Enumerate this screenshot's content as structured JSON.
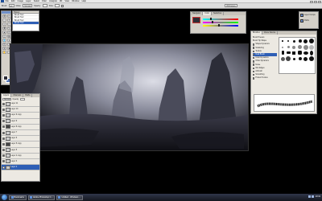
{
  "menubar": {
    "items": [
      "File",
      "Edit",
      "Image",
      "Layer",
      "Select",
      "Filter",
      "Analysis",
      "3D",
      "View",
      "Window",
      "Help"
    ]
  },
  "options_bar": {
    "brush_label": "Brush:",
    "mode_label": "Mode:",
    "mode_value": "Normal",
    "opacity_label": "Opacity:",
    "flow_label": "Flow:",
    "workspace_label": "Workspace"
  },
  "history": {
    "title": "History",
    "items": [
      "Brush Tool",
      "Brush Tool",
      "Brush Tool",
      "Brush Tool"
    ]
  },
  "navigator": {
    "tabs": [
      "Navigator",
      "Color",
      "Swatches"
    ],
    "active_tab": "Color"
  },
  "right_strip": {
    "items": [
      "Layer Comps",
      "Paths"
    ]
  },
  "brushes": {
    "tabs": [
      "Brushes",
      "Clone Source"
    ],
    "options": [
      "Brush Presets",
      "Brush Tip Shape",
      "Shape Dynamics",
      "Scattering",
      "Texture",
      "Dual Brush",
      "Color Dynamics",
      "Other Dynamics",
      "Noise",
      "Wet Edges",
      "Airbrush",
      "Smoothing",
      "Protect Texture"
    ],
    "selected_option": "Dual Brush"
  },
  "layers": {
    "tabs": [
      "Layers",
      "Channels",
      "Paths"
    ],
    "blend_mode": "Normal",
    "opacity_label": "Opacity:",
    "rows": [
      {
        "name": "Layer 11",
        "dark": false
      },
      {
        "name": "Layer 10",
        "dark": false
      },
      {
        "name": "Layer 9 copy",
        "dark": false
      },
      {
        "name": "Layer 9",
        "dark": false
      },
      {
        "name": "Layer 8 copy",
        "dark": true
      },
      {
        "name": "Layer 7",
        "dark": false
      },
      {
        "name": "Layer 6",
        "dark": false
      },
      {
        "name": "Layer 5 copy",
        "dark": true
      },
      {
        "name": "Layer 5",
        "dark": false
      },
      {
        "name": "Layer 4 copy",
        "dark": false
      },
      {
        "name": "Layer 3",
        "dark": false
      },
      {
        "name": "Layer 2",
        "dark": false
      }
    ],
    "selected_row": 11
  },
  "taskbar": {
    "tasks": [
      "Bookmarks",
      "Adobe Photoshop C...",
      "Untitled - Windows ..."
    ],
    "clock": "10:41"
  },
  "colors": {
    "fg": "#2c2c36",
    "bg": "#5575b5",
    "selection": "#2f5fb5"
  }
}
